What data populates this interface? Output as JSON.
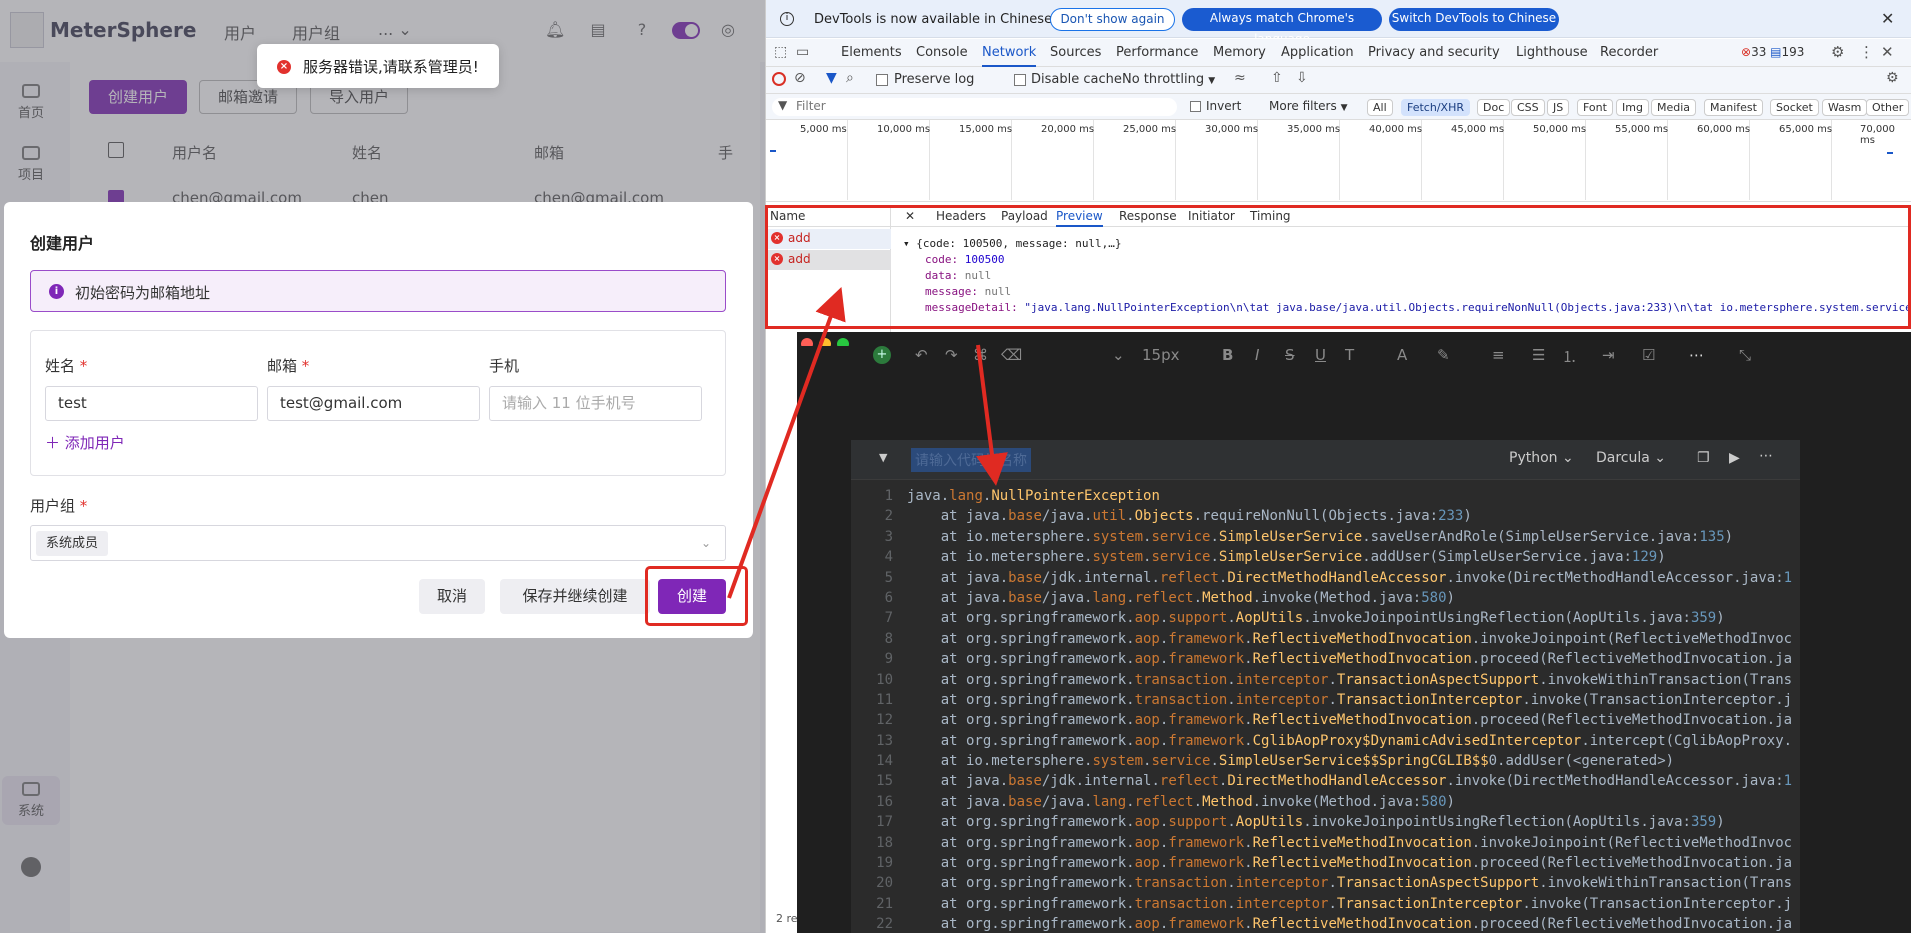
{
  "app": {
    "name": "MeterSphere",
    "nav": [
      "用户",
      "用户组",
      "..."
    ],
    "sidebar": [
      "首页",
      "项目",
      "系统"
    ],
    "toolbar": {
      "create_user": "创建用户",
      "email_invite": "邮箱邀请",
      "import_user": "导入用户"
    },
    "table": {
      "headers": [
        "用户名",
        "姓名",
        "邮箱",
        "手"
      ],
      "row": [
        "chen@gmail.com",
        "chen",
        "chen@gmail.com"
      ]
    }
  },
  "toast": {
    "message": "服务器错误,请联系管理员!"
  },
  "modal": {
    "title": "创建用户",
    "info": "初始密码为邮箱地址",
    "fields": {
      "name": {
        "label": "姓名",
        "value": "test"
      },
      "email": {
        "label": "邮箱",
        "value": "test@gmail.com"
      },
      "phone": {
        "label": "手机",
        "placeholder": "请输入 11 位手机号"
      }
    },
    "required_mark": "*",
    "add_user": "添加用户",
    "group_label": "用户组",
    "group_tag": "系统成员",
    "buttons": {
      "cancel": "取消",
      "save_continue": "保存并继续创建",
      "create": "创建"
    }
  },
  "devtools": {
    "banner": {
      "text": "DevTools is now available in Chinese",
      "dont_show": "Don't show again",
      "match": "Always match Chrome's language",
      "switch": "Switch DevTools to Chinese"
    },
    "tabs": [
      "Elements",
      "Console",
      "Network",
      "Sources",
      "Performance",
      "Memory",
      "Application",
      "Privacy and security",
      "Lighthouse",
      "Recorder"
    ],
    "active_tab": "Network",
    "errors": "33",
    "messages": "193",
    "toolbar": {
      "preserve_log": "Preserve log",
      "disable_cache": "Disable cache",
      "throttling": "No throttling"
    },
    "filter": {
      "placeholder": "Filter",
      "invert": "Invert",
      "more_filters": "More filters",
      "chips": [
        "All",
        "Fetch/XHR",
        "Doc",
        "CSS",
        "JS",
        "Font",
        "Img",
        "Media",
        "Manifest",
        "Socket",
        "Wasm",
        "Other"
      ],
      "active_chip": "Fetch/XHR"
    },
    "timeline_labels": [
      "5,000 ms",
      "10,000 ms",
      "15,000 ms",
      "20,000 ms",
      "25,000 ms",
      "30,000 ms",
      "35,000 ms",
      "40,000 ms",
      "45,000 ms",
      "50,000 ms",
      "55,000 ms",
      "60,000 ms",
      "65,000 ms",
      "70,000 ms"
    ],
    "requests": {
      "header": "Name",
      "items": [
        "add",
        "add"
      ],
      "footer": "2 re"
    },
    "detail_tabs": [
      "Headers",
      "Payload",
      "Preview",
      "Response",
      "Initiator",
      "Timing"
    ],
    "active_detail_tab": "Preview",
    "preview": {
      "summary": "{code: 100500, message: null,…}",
      "code_key": "code",
      "code_val": "100500",
      "data_key": "data",
      "data_val": "null",
      "message_key": "message",
      "message_val": "null",
      "detail_key": "messageDetail",
      "detail_val": "\"java.lang.NullPointerException\\n\\tat java.base/java.util.Objects.requireNonNull(Objects.java:233)\\n\\tat io.metersphere.system.service"
    }
  },
  "editor": {
    "font_size": "15px",
    "placeholder": "请输入代码块名称",
    "language": "Python",
    "theme": "Darcula",
    "code_lines": [
      "java.lang.NullPointerException",
      "    at java.base/java.util.Objects.requireNonNull(Objects.java:233)",
      "    at io.metersphere.system.service.SimpleUserService.saveUserAndRole(SimpleUserService.java:135)",
      "    at io.metersphere.system.service.SimpleUserService.addUser(SimpleUserService.java:129)",
      "    at java.base/jdk.internal.reflect.DirectMethodHandleAccessor.invoke(DirectMethodHandleAccessor.java:1",
      "    at java.base/java.lang.reflect.Method.invoke(Method.java:580)",
      "    at org.springframework.aop.support.AopUtils.invokeJoinpointUsingReflection(AopUtils.java:359)",
      "    at org.springframework.aop.framework.ReflectiveMethodInvocation.invokeJoinpoint(ReflectiveMethodInvoc",
      "    at org.springframework.aop.framework.ReflectiveMethodInvocation.proceed(ReflectiveMethodInvocation.ja",
      "    at org.springframework.transaction.interceptor.TransactionAspectSupport.invokeWithinTransaction(Trans",
      "    at org.springframework.transaction.interceptor.TransactionInterceptor.invoke(TransactionInterceptor.j",
      "    at org.springframework.aop.framework.ReflectiveMethodInvocation.proceed(ReflectiveMethodInvocation.ja",
      "    at org.springframework.aop.framework.CglibAopProxy$DynamicAdvisedInterceptor.intercept(CglibAopProxy.",
      "    at io.metersphere.system.service.SimpleUserService$$SpringCGLIB$$0.addUser(<generated>)",
      "    at java.base/jdk.internal.reflect.DirectMethodHandleAccessor.invoke(DirectMethodHandleAccessor.java:1",
      "    at java.base/java.lang.reflect.Method.invoke(Method.java:580)",
      "    at org.springframework.aop.support.AopUtils.invokeJoinpointUsingReflection(AopUtils.java:359)",
      "    at org.springframework.aop.framework.ReflectiveMethodInvocation.invokeJoinpoint(ReflectiveMethodInvoc",
      "    at org.springframework.aop.framework.ReflectiveMethodInvocation.proceed(ReflectiveMethodInvocation.ja",
      "    at org.springframework.transaction.interceptor.TransactionAspectSupport.invokeWithinTransaction(Trans",
      "    at org.springframework.transaction.interceptor.TransactionInterceptor.invoke(TransactionInterceptor.j",
      "    at org.springframework.aop.framework.ReflectiveMethodInvocation.proceed(ReflectiveMethodInvocation.ja"
    ]
  },
  "colors": {
    "brand": "#7f27b7",
    "error": "#e2312d",
    "annotation": "#e02a22",
    "devtools_blue": "#1a57c8"
  }
}
